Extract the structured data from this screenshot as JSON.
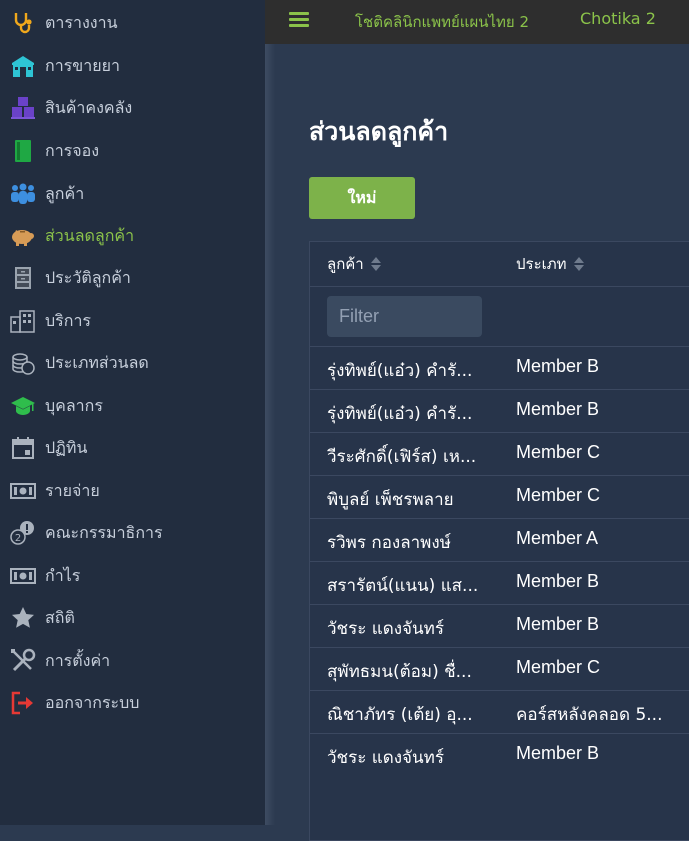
{
  "sidebar": {
    "items": [
      {
        "label": "ตารางงาน",
        "icon": "stethoscope-icon"
      },
      {
        "label": "การขายยา",
        "icon": "pharmacy-store-icon"
      },
      {
        "label": "สินค้าคงคลัง",
        "icon": "inventory-boxes-icon"
      },
      {
        "label": "การจอง",
        "icon": "booking-book-icon"
      },
      {
        "label": "ลูกค้า",
        "icon": "customers-group-icon"
      },
      {
        "label": "ส่วนลดลูกค้า",
        "icon": "piggy-bank-icon",
        "active": true
      },
      {
        "label": "ประวัติลูกค้า",
        "icon": "filing-cabinet-icon"
      },
      {
        "label": "บริการ",
        "icon": "services-building-icon"
      },
      {
        "label": "ประเภทส่วนลด",
        "icon": "coins-stack-icon"
      },
      {
        "label": "บุคลากร",
        "icon": "graduation-cap-icon"
      },
      {
        "label": "ปฏิทิน",
        "icon": "calendar-icon"
      },
      {
        "label": "รายจ่าย",
        "icon": "money-bill-icon"
      },
      {
        "label": "คณะกรรมาธิการ",
        "icon": "commission-coins-icon"
      },
      {
        "label": "กำไร",
        "icon": "money-bill-profit-icon"
      },
      {
        "label": "สถิติ",
        "icon": "star-icon"
      },
      {
        "label": "การตั้งค่า",
        "icon": "tools-icon"
      },
      {
        "label": "ออกจากระบบ",
        "icon": "logout-icon"
      }
    ]
  },
  "topbar": {
    "clinic_name": "โชติคลินิกแพทย์แผนไทย 2",
    "user_name": "Chotika 2"
  },
  "main": {
    "title": "ส่วนลดลูกค้า",
    "new_button_label": "ใหม่",
    "table": {
      "columns": [
        "ลูกค้า",
        "ประเภท"
      ],
      "filter_placeholder": "Filter",
      "rows": [
        [
          "รุ่งทิพย์(แอ๋ว) คำรั...",
          "Member B"
        ],
        [
          "รุ่งทิพย์(แอ๋ว) คำรั...",
          "Member B"
        ],
        [
          "วีระศักดิ์(เฟิร์ส) เห...",
          "Member C"
        ],
        [
          "พิบูลย์ เพ็ชรพลาย",
          "Member C"
        ],
        [
          "รวิพร กองลาพงษ์",
          "Member A"
        ],
        [
          "สรารัตน์(แนน) แส...",
          "Member B"
        ],
        [
          "วัชระ แดงจันทร์",
          "Member B"
        ],
        [
          "สุพัทธมน(ต้อม) ชื่...",
          "Member C"
        ],
        [
          "ณิชาภัทร (เต้ย) อุ...",
          "คอร์สหลังคลอด 5..."
        ],
        [
          "วัชระ แดงจันทร์",
          "Member B"
        ]
      ]
    }
  },
  "colors": {
    "accent": "#8bc34a",
    "button": "#7db24a",
    "sidebar_bg": "#222d3f",
    "main_bg": "#2c3a50",
    "topbar_bg": "#2e2e2e"
  }
}
